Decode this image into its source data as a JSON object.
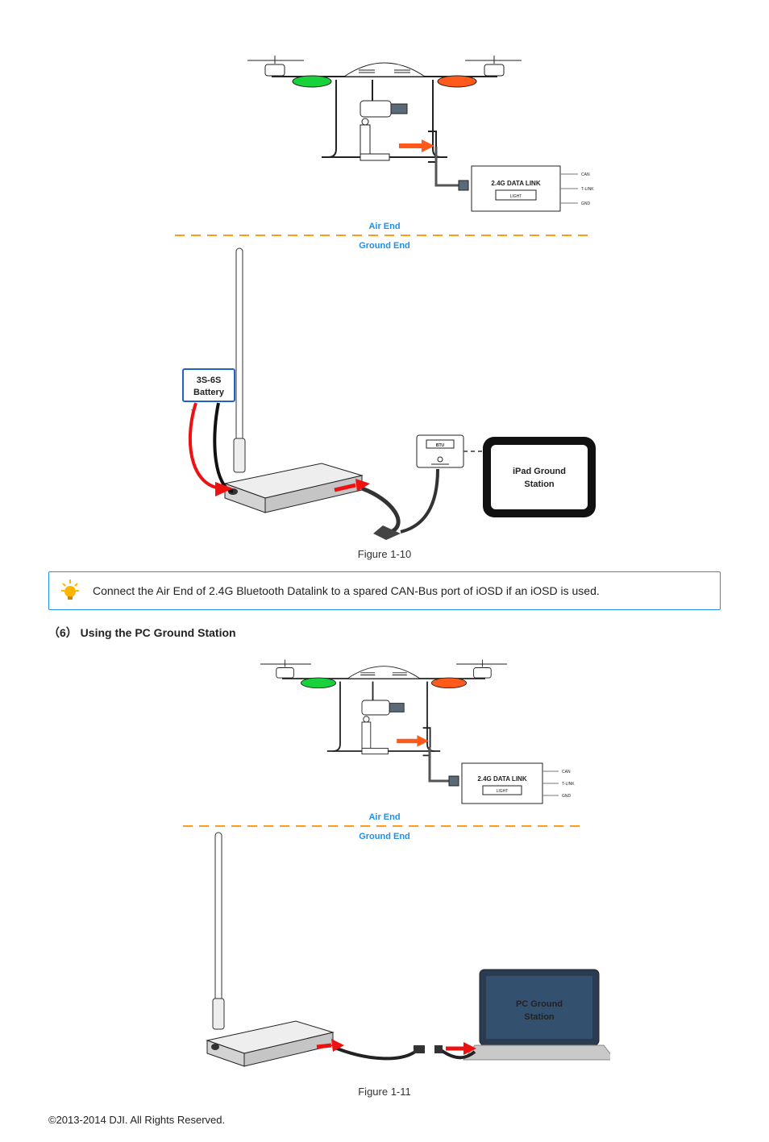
{
  "figure1": {
    "caption": "Figure 1-10",
    "labels": {
      "air_end": "Air End",
      "ground_end": "Ground End",
      "datalink": "2.4G DATA LINK",
      "datalink_sub": "LIGHT",
      "battery_l1": "3S-6S",
      "battery_l2": "Battery",
      "btu": "BTU",
      "ipad_l1": "iPad Ground",
      "ipad_l2": "Station",
      "port_can": "CAN",
      "port_tlink": "T-LINK",
      "port_gnd": "GND"
    }
  },
  "callout": {
    "text": "Connect the Air End of 2.4G Bluetooth Datalink to a spared CAN-Bus port of iOSD if an iOSD is used."
  },
  "section6": {
    "title": "（6） Using the PC Ground Station"
  },
  "figure2": {
    "caption": "Figure 1-11",
    "labels": {
      "air_end": "Air End",
      "ground_end": "Ground End",
      "datalink": "2.4G DATA LINK",
      "datalink_sub": "LIGHT",
      "pc_l1": "PC Ground",
      "pc_l2": "Station",
      "port_can": "CAN",
      "port_tlink": "T-LINK",
      "port_gnd": "GND"
    }
  },
  "footer": {
    "copyright": "©2013-2014 DJI. All Rights Reserved."
  }
}
